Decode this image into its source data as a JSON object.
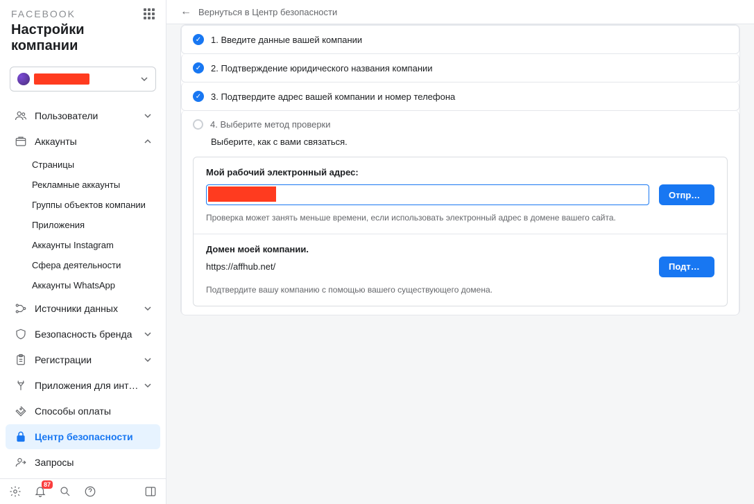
{
  "brand": "FACEBOOK",
  "page_title": "Настройки компании",
  "back_link": "Вернуться в Центр безопасности",
  "notification_count": "87",
  "sidebar": {
    "items": [
      {
        "label": "Пользователи",
        "expanded": false
      },
      {
        "label": "Аккаунты",
        "expanded": true,
        "children": [
          "Страницы",
          "Рекламные аккаунты",
          "Группы объектов компании",
          "Приложения",
          "Аккаунты Instagram",
          "Сфера деятельности",
          "Аккаунты WhatsApp"
        ]
      },
      {
        "label": "Источники данных",
        "expanded": false
      },
      {
        "label": "Безопасность бренда",
        "expanded": false
      },
      {
        "label": "Регистрации",
        "expanded": false
      },
      {
        "label": "Приложения для интег…",
        "expanded": false
      },
      {
        "label": "Способы оплаты",
        "no_chevron": true
      },
      {
        "label": "Центр безопасности",
        "no_chevron": true,
        "active": true
      },
      {
        "label": "Запросы",
        "no_chevron": true
      }
    ]
  },
  "steps": [
    {
      "title": "1. Введите данные вашей компании",
      "done": true
    },
    {
      "title": "2. Подтверждение юридического названия компании",
      "done": true
    },
    {
      "title": "3. Подтвердите адрес вашей компании и номер телефона",
      "done": true
    },
    {
      "title": "4. Выберите метод проверки",
      "done": false
    }
  ],
  "step4": {
    "subtitle": "Выберите, как с вами связаться.",
    "email_label": "Мой рабочий электронный адрес:",
    "email_button": "Отправ…",
    "email_hint": "Проверка может занять меньше времени, если использовать электронный адрес в домене вашего сайта.",
    "domain_label": "Домен моей компании.",
    "domain_url": "https://affhub.net/",
    "domain_button": "Подтве…",
    "domain_hint": "Подтвердите вашу компанию с помощью вашего существующего домена."
  }
}
